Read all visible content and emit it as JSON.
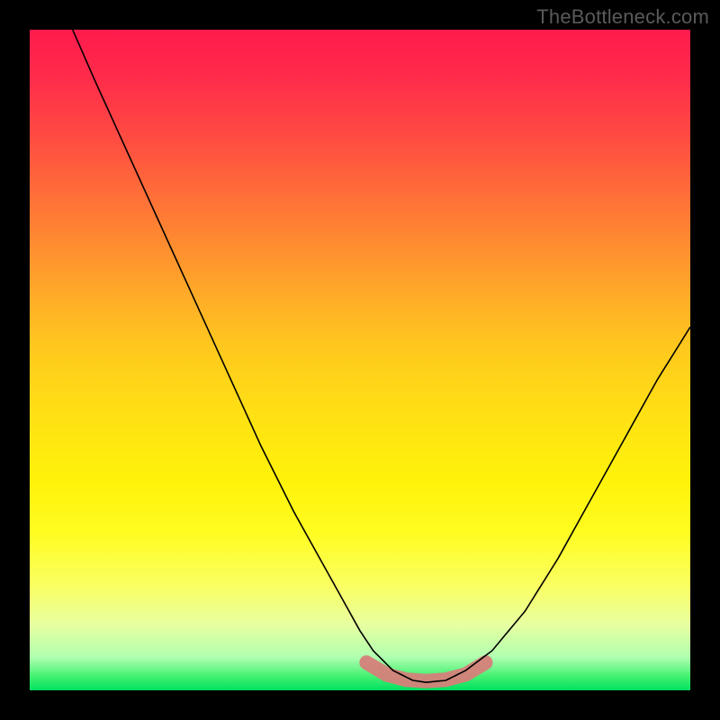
{
  "watermark": "TheBottleneck.com",
  "chart_data": {
    "type": "line",
    "title": "",
    "xlabel": "",
    "ylabel": "",
    "xlim": [
      0,
      100
    ],
    "ylim": [
      0,
      100
    ],
    "series": [
      {
        "name": "bottleneck-curve",
        "x": [
          6.5,
          10,
          15,
          20,
          25,
          30,
          35,
          40,
          45,
          50,
          52,
          55,
          58,
          60,
          63,
          66,
          70,
          75,
          80,
          85,
          90,
          95,
          100
        ],
        "y": [
          100,
          92,
          81,
          70,
          59,
          48,
          37,
          27,
          18,
          9,
          6,
          3,
          1.5,
          1.2,
          1.5,
          3,
          6,
          12,
          20,
          29,
          38,
          47,
          55
        ]
      },
      {
        "name": "optimal-range-band",
        "x": [
          51,
          54,
          57,
          60,
          63,
          66,
          69
        ],
        "y": [
          4.2,
          2.4,
          1.6,
          1.4,
          1.6,
          2.4,
          4.2
        ]
      }
    ],
    "gradient": {
      "top_color": "#ff1a4d",
      "mid_color": "#ffe014",
      "bottom_color": "#00e060"
    }
  }
}
